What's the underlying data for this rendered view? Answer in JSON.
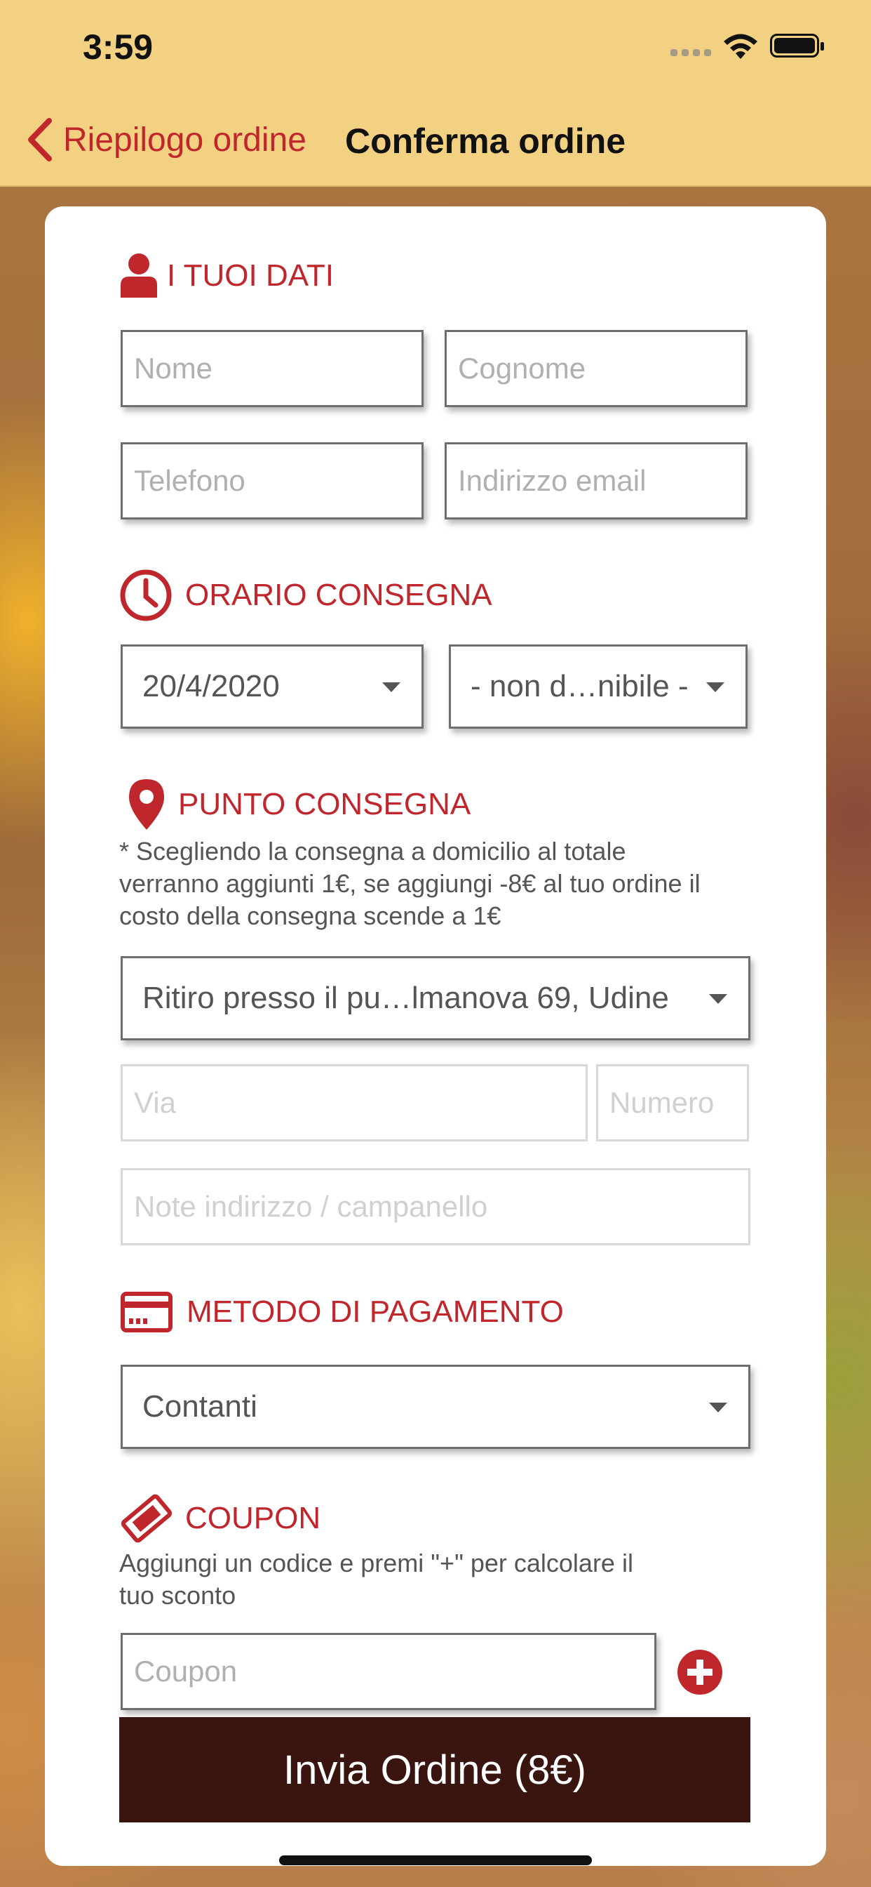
{
  "status_bar": {
    "time": "3:59"
  },
  "nav": {
    "back_label": "Riepilogo ordine",
    "title": "Conferma ordine"
  },
  "sections": {
    "personal": {
      "title": "I TUOI DATI",
      "name_placeholder": "Nome",
      "surname_placeholder": "Cognome",
      "phone_placeholder": "Telefono",
      "email_placeholder": "Indirizzo email"
    },
    "delivery_time": {
      "title": "ORARIO CONSEGNA",
      "date_value": "20/4/2020",
      "time_value": "- non d…nibile -"
    },
    "delivery_point": {
      "title": "PUNTO CONSEGNA",
      "note_line1": "* Scegliendo la consegna a domicilio al totale",
      "note_line2": "verranno aggiunti 1€, se aggiungi -8€ al tuo ordine il",
      "note_line3": "costo della consegna scende a 1€",
      "selected": "Ritiro presso il pu…lmanova 69, Udine",
      "street_placeholder": "Via",
      "number_placeholder": "Numero",
      "address_note_placeholder": "Note indirizzo / campanello"
    },
    "payment": {
      "title": "METODO DI PAGAMENTO",
      "selected": "Contanti"
    },
    "coupon": {
      "title": "COUPON",
      "note_line1": "Aggiungi un codice e premi \"+\" per calcolare il",
      "note_line2": "tuo sconto",
      "placeholder": "Coupon"
    }
  },
  "submit_label": "Invia Ordine (8€)",
  "colors": {
    "accent": "#c0272d",
    "header_bg": "#f3d182",
    "submit_bg": "#3a1510"
  }
}
